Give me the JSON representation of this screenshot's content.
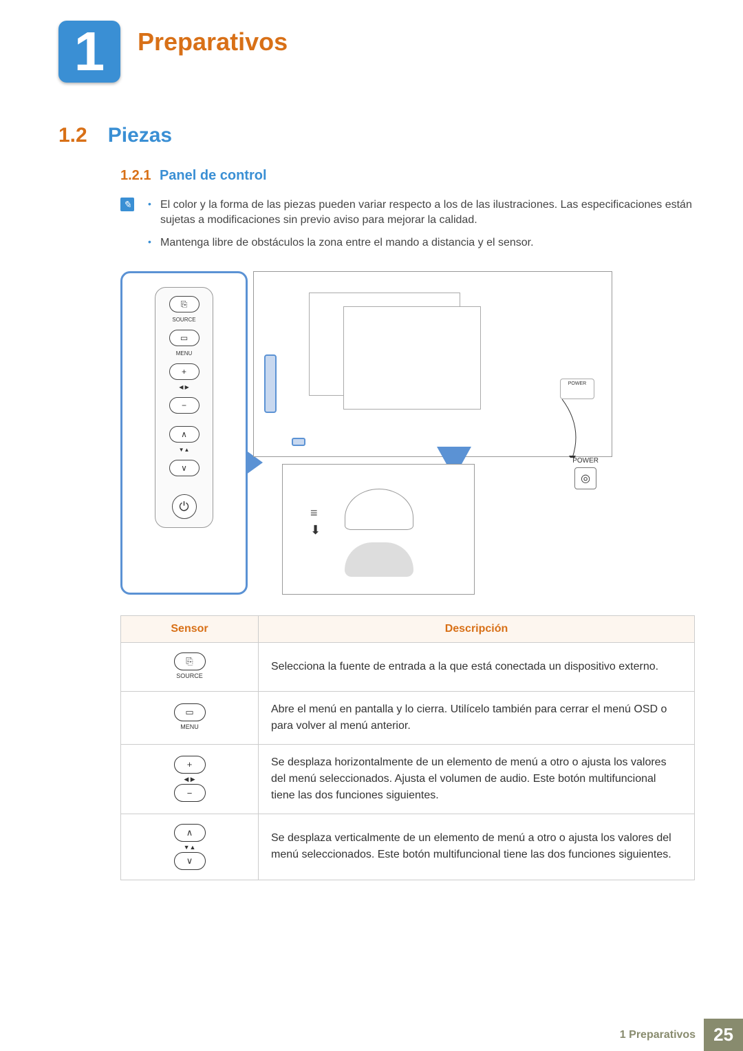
{
  "chapter": {
    "number": "1",
    "title": "Preparativos"
  },
  "section": {
    "number": "1.2",
    "title": "Piezas"
  },
  "subsection": {
    "number": "1.2.1",
    "title": "Panel de control"
  },
  "notes": {
    "bullet1": "El color y la forma de las piezas pueden variar respecto a los de las ilustraciones. Las especificaciones están sujetas a modificaciones sin previo aviso para mejorar la calidad.",
    "bullet2": "Mantenga libre de obstáculos la zona entre el mando a distancia y el sensor."
  },
  "diagram": {
    "buttons": {
      "source": "SOURCE",
      "menu": "MENU",
      "plus": "+",
      "minus": "−",
      "leftright": "◀ ▶",
      "updown": "▼▲",
      "up": "∧",
      "down": "∨",
      "power": "⏻"
    },
    "power_label": "POWER"
  },
  "table": {
    "header_sensor": "Sensor",
    "header_desc": "Descripción",
    "rows": [
      {
        "btn_glyph": "⎘",
        "btn_label": "SOURCE",
        "desc": "Selecciona la fuente de entrada a la que está conectada un dispositivo externo."
      },
      {
        "btn_glyph": "▭",
        "btn_label": "MENU",
        "desc": "Abre el menú en pantalla y lo cierra. Utilícelo también para cerrar el menú OSD o para volver al menú anterior."
      },
      {
        "btn_glyph_top": "+",
        "btn_mid": "◀ ▶",
        "btn_glyph_bot": "−",
        "desc": "Se desplaza horizontalmente de un elemento de menú a otro o ajusta los valores del menú seleccionados. Ajusta el volumen de audio. Este botón multifuncional tiene las dos funciones siguientes."
      },
      {
        "btn_glyph_top": "∧",
        "btn_mid": "▼▲",
        "btn_glyph_bot": "∨",
        "desc": "Se desplaza verticalmente de un elemento de menú a otro o ajusta los valores del menú seleccionados. Este botón multifuncional tiene las dos funciones siguientes."
      }
    ]
  },
  "footer": {
    "label": "1 Preparativos",
    "page": "25"
  }
}
